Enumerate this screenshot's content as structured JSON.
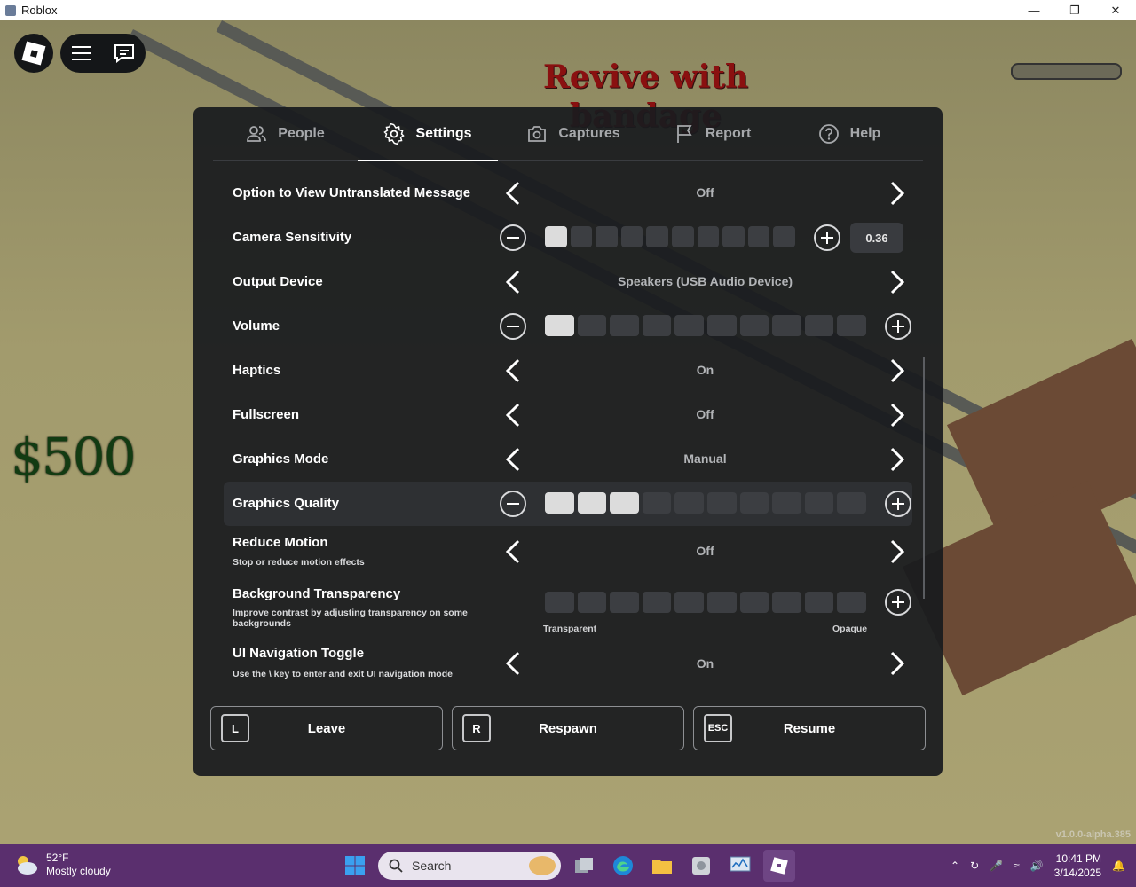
{
  "window": {
    "title": "Roblox"
  },
  "hud": {
    "money": "$500",
    "revive_text": "Revive with bandage",
    "version": "v1.0.0-alpha.385"
  },
  "tabs": [
    {
      "label": "People",
      "icon": "people-icon",
      "active": false
    },
    {
      "label": "Settings",
      "icon": "gear-icon",
      "active": true
    },
    {
      "label": "Captures",
      "icon": "camera-icon",
      "active": false
    },
    {
      "label": "Report",
      "icon": "flag-icon",
      "active": false
    },
    {
      "label": "Help",
      "icon": "help-icon",
      "active": false
    }
  ],
  "settings": {
    "untranslated": {
      "label": "Option to View Untranslated Message",
      "value": "Off"
    },
    "camera_sensitivity": {
      "label": "Camera Sensitivity",
      "value": "0.36",
      "filled_steps": 1,
      "total_steps": 10
    },
    "output_device": {
      "label": "Output Device",
      "value": "Speakers (USB Audio Device)"
    },
    "volume": {
      "label": "Volume",
      "filled_steps": 1,
      "total_steps": 10
    },
    "haptics": {
      "label": "Haptics",
      "value": "On"
    },
    "fullscreen": {
      "label": "Fullscreen",
      "value": "Off"
    },
    "graphics_mode": {
      "label": "Graphics Mode",
      "value": "Manual"
    },
    "graphics_quality": {
      "label": "Graphics Quality",
      "filled_steps": 3,
      "total_steps": 10
    },
    "reduce_motion": {
      "label": "Reduce Motion",
      "description": "Stop or reduce motion effects",
      "value": "Off"
    },
    "background_transparency": {
      "label": "Background Transparency",
      "description": "Improve contrast by adjusting transparency on some backgrounds",
      "filled_steps": 0,
      "total_steps": 10,
      "min_label": "Transparent",
      "max_label": "Opaque"
    },
    "ui_nav_toggle": {
      "label": "UI Navigation Toggle",
      "description": "Use the \\ key to enter and exit UI navigation mode",
      "value": "On"
    }
  },
  "footer": {
    "leave": {
      "key": "L",
      "label": "Leave"
    },
    "respawn": {
      "key": "R",
      "label": "Respawn"
    },
    "resume": {
      "key": "ESC",
      "label": "Resume"
    }
  },
  "taskbar": {
    "weather_temp": "52°F",
    "weather_desc": "Mostly cloudy",
    "search_placeholder": "Search",
    "time": "10:41 PM",
    "date": "3/14/2025"
  },
  "colors": {
    "panel": "#191b1e",
    "accent": "#ffffff",
    "taskbar": "#5a2f6e",
    "money": "#123b12",
    "revive": "#8a1010"
  }
}
